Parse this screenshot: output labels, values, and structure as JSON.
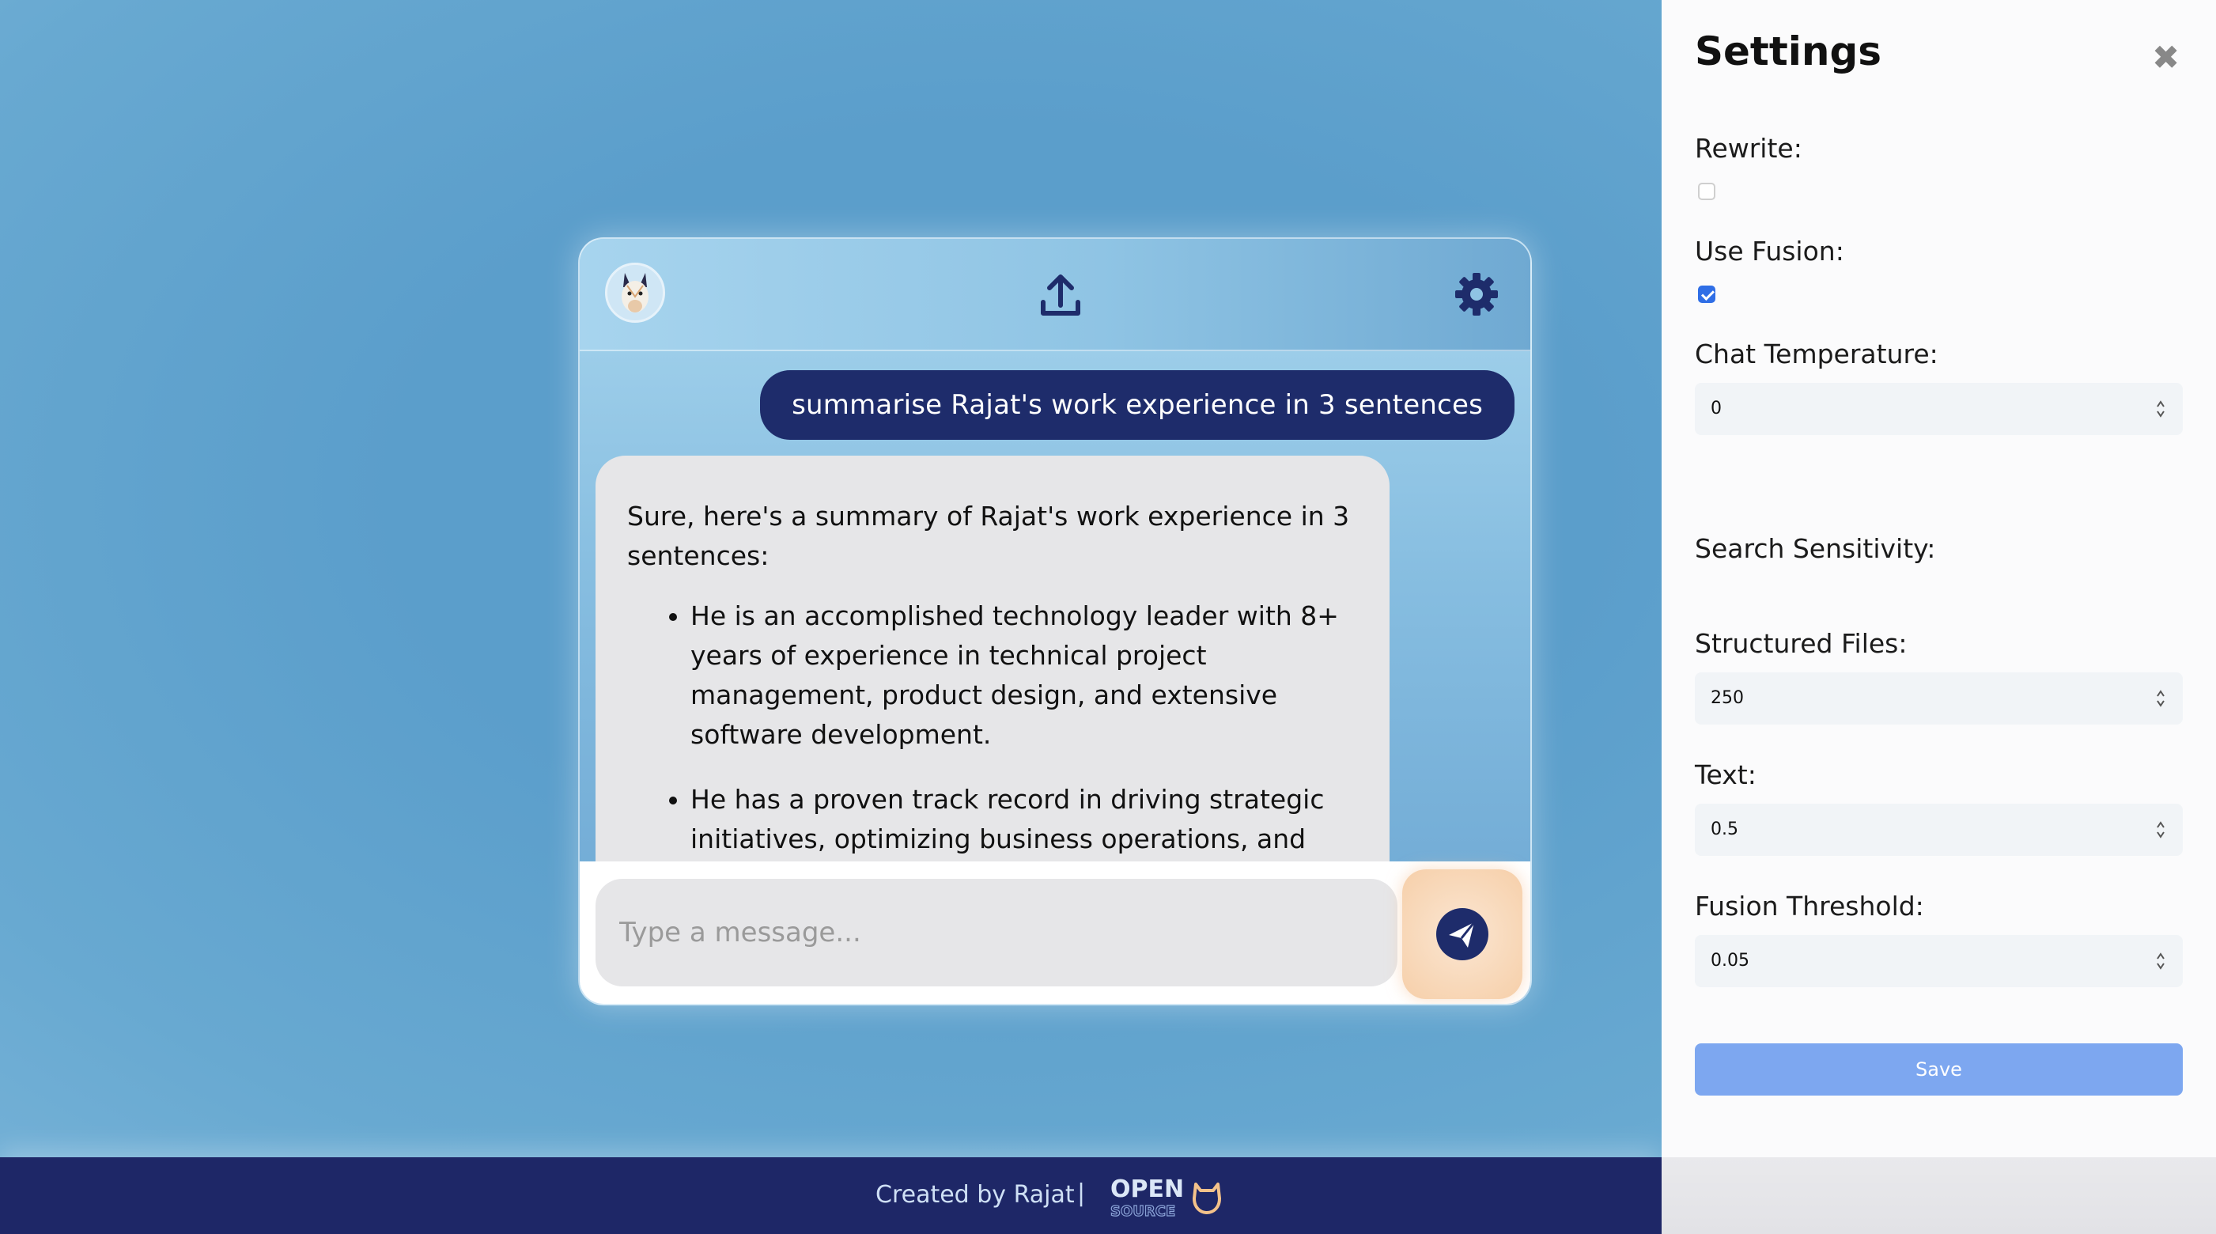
{
  "chat": {
    "user_message": "summarise Rajat's work experience in 3 sentences",
    "bot_intro": "Sure, here's a summary of Rajat's work experience in 3 sentences:",
    "bot_points": [
      "He is an accomplished technology leader with 8+ years of experience in technical project management, product design, and extensive software development.",
      "He has a proven track record in driving strategic initiatives, optimizing business operations, and"
    ],
    "input_placeholder": "Type a message...",
    "icons": {
      "avatar": "llama-avatar-icon",
      "upload": "upload-icon",
      "settings": "gear-icon",
      "send": "send-icon"
    }
  },
  "footer": {
    "credit": "Created by Rajat",
    "separator": "|",
    "logo_top": "OPEN",
    "logo_bottom": "SOURCE"
  },
  "settings": {
    "title": "Settings",
    "close_symbol": "✖",
    "rewrite_label": "Rewrite:",
    "rewrite_checked": false,
    "fusion_label": "Use Fusion:",
    "fusion_checked": true,
    "chat_temperature_label": "Chat Temperature:",
    "chat_temperature_value": "0",
    "search_sensitivity_label": "Search Sensitivity:",
    "structured_files_label": "Structured Files:",
    "structured_files_value": "250",
    "text_label": "Text:",
    "text_value": "0.5",
    "fusion_threshold_label": "Fusion Threshold:",
    "fusion_threshold_value": "0.05",
    "save_label": "Save"
  },
  "colors": {
    "navy": "#1e2c6b",
    "footer_bg": "#1e2767",
    "save_blue": "#7da7f0",
    "checkbox_blue": "#2f6ee6",
    "bubble_grey": "#e6e6e8",
    "send_peach": "#f6cfa9"
  }
}
